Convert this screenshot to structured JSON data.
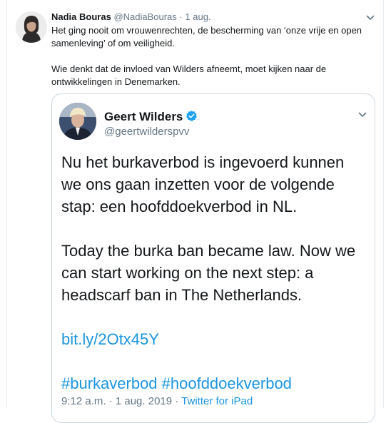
{
  "tweet": {
    "author_name": "Nadia Bouras",
    "author_handle": "@NadiaBouras",
    "separator": "·",
    "date": "1 aug.",
    "paragraph_1": "Het ging nooit om vrouwenrechten, de bescherming van ‘onze vrije en open samenleving’ of om veiligheid.",
    "paragraph_2": "Wie denkt dat de invloed van Wilders afneemt, moet kijken naar de ontwikkelingen in Denemarken."
  },
  "quoted_tweet": {
    "author_name": "Geert Wilders",
    "author_handle": "@geertwilderspvv",
    "paragraph_1": "Nu het burkaverbod is ingevoerd kunnen we ons gaan inzetten voor de volgende stap: een hoofddoekverbod in NL.",
    "paragraph_2": "Today the burka ban became law. Now we can start working on the next step: a headscarf ban in The Netherlands.",
    "link": "bit.ly/2Otx45Y",
    "hashtags": "#burkaverbod #hoofddoekverbod",
    "timestamp": "9:12 a.m. · 1 aug. 2019",
    "meta_separator": " · ",
    "source": "Twitter for iPad"
  },
  "icons": {
    "caret": "chevron-down-icon",
    "verified": "verified-badge-icon"
  },
  "colors": {
    "link": "#1b95e0",
    "muted": "#657786",
    "border": "#ccd6dd"
  }
}
